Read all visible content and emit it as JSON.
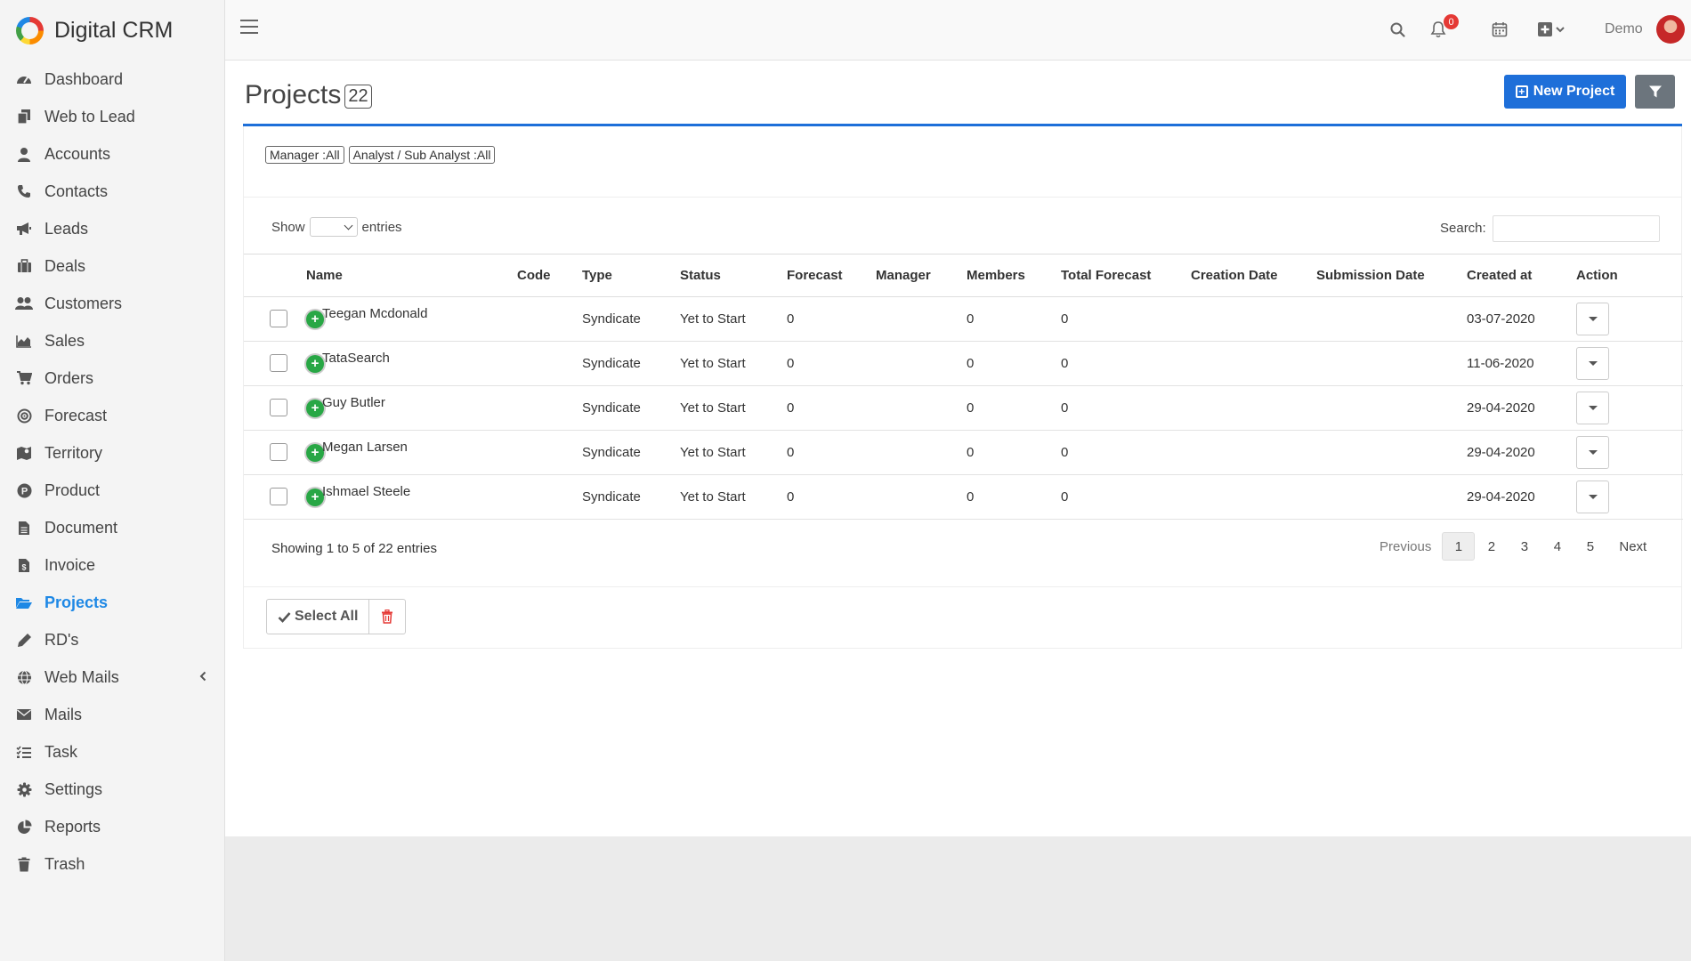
{
  "app": {
    "title": "Digital CRM"
  },
  "sidebar": {
    "items": [
      {
        "label": "Dashboard",
        "icon": "dashboard-icon"
      },
      {
        "label": "Web to Lead",
        "icon": "copy-icon"
      },
      {
        "label": "Accounts",
        "icon": "user-icon"
      },
      {
        "label": "Contacts",
        "icon": "phone-icon"
      },
      {
        "label": "Leads",
        "icon": "megaphone-icon"
      },
      {
        "label": "Deals",
        "icon": "briefcase-icon"
      },
      {
        "label": "Customers",
        "icon": "users-icon"
      },
      {
        "label": "Sales",
        "icon": "area-chart-icon"
      },
      {
        "label": "Orders",
        "icon": "cart-icon"
      },
      {
        "label": "Forecast",
        "icon": "target-icon"
      },
      {
        "label": "Territory",
        "icon": "map-icon"
      },
      {
        "label": "Product",
        "icon": "product-icon"
      },
      {
        "label": "Document",
        "icon": "file-icon"
      },
      {
        "label": "Invoice",
        "icon": "invoice-icon"
      },
      {
        "label": "Projects",
        "icon": "folder-open-icon",
        "active": true
      },
      {
        "label": "RD's",
        "icon": "pen-icon"
      },
      {
        "label": "Web Mails",
        "icon": "globe-icon"
      },
      {
        "label": "Mails",
        "icon": "envelope-icon"
      },
      {
        "label": "Task",
        "icon": "tasks-icon"
      },
      {
        "label": "Settings",
        "icon": "gear-icon"
      },
      {
        "label": "Reports",
        "icon": "pie-chart-icon"
      },
      {
        "label": "Trash",
        "icon": "trash-icon"
      }
    ]
  },
  "topbar": {
    "notifications_count": "0",
    "user_name": "Demo"
  },
  "page": {
    "title": "Projects",
    "count": "22",
    "new_button": "New Project",
    "filters": [
      "Manager :All",
      "Analyst / Sub Analyst :All"
    ],
    "show_label": "Show",
    "entries_label": "entries",
    "search_label": "Search:",
    "search_value": ""
  },
  "table": {
    "columns": [
      "Name",
      "Code",
      "Type",
      "Status",
      "Forecast",
      "Manager",
      "Members",
      "Total Forecast",
      "Creation Date",
      "Submission Date",
      "Created at",
      "Action"
    ],
    "rows": [
      {
        "name": "Teegan Mcdonald",
        "code": "",
        "type": "Syndicate",
        "status": "Yet to Start",
        "forecast": "0",
        "manager": "",
        "members": "0",
        "total_forecast": "0",
        "creation_date": "",
        "submission_date": "",
        "created_at": "03-07-2020"
      },
      {
        "name": "TataSearch",
        "code": "",
        "type": "Syndicate",
        "status": "Yet to Start",
        "forecast": "0",
        "manager": "",
        "members": "0",
        "total_forecast": "0",
        "creation_date": "",
        "submission_date": "",
        "created_at": "11-06-2020"
      },
      {
        "name": "Guy Butler",
        "code": "",
        "type": "Syndicate",
        "status": "Yet to Start",
        "forecast": "0",
        "manager": "",
        "members": "0",
        "total_forecast": "0",
        "creation_date": "",
        "submission_date": "",
        "created_at": "29-04-2020"
      },
      {
        "name": "Megan Larsen",
        "code": "",
        "type": "Syndicate",
        "status": "Yet to Start",
        "forecast": "0",
        "manager": "",
        "members": "0",
        "total_forecast": "0",
        "creation_date": "",
        "submission_date": "",
        "created_at": "29-04-2020"
      },
      {
        "name": "Ishmael Steele",
        "code": "",
        "type": "Syndicate",
        "status": "Yet to Start",
        "forecast": "0",
        "manager": "",
        "members": "0",
        "total_forecast": "0",
        "creation_date": "",
        "submission_date": "",
        "created_at": "29-04-2020"
      }
    ]
  },
  "pagination": {
    "info": "Showing 1 to 5 of 22 entries",
    "previous": "Previous",
    "pages": [
      "1",
      "2",
      "3",
      "4",
      "5"
    ],
    "current": "1",
    "next": "Next"
  },
  "bulk": {
    "select_all": "Select All"
  },
  "colors": {
    "accent": "#1e6fd9",
    "success": "#28a745",
    "danger": "#e53935",
    "filter_button": "#6c757d"
  }
}
